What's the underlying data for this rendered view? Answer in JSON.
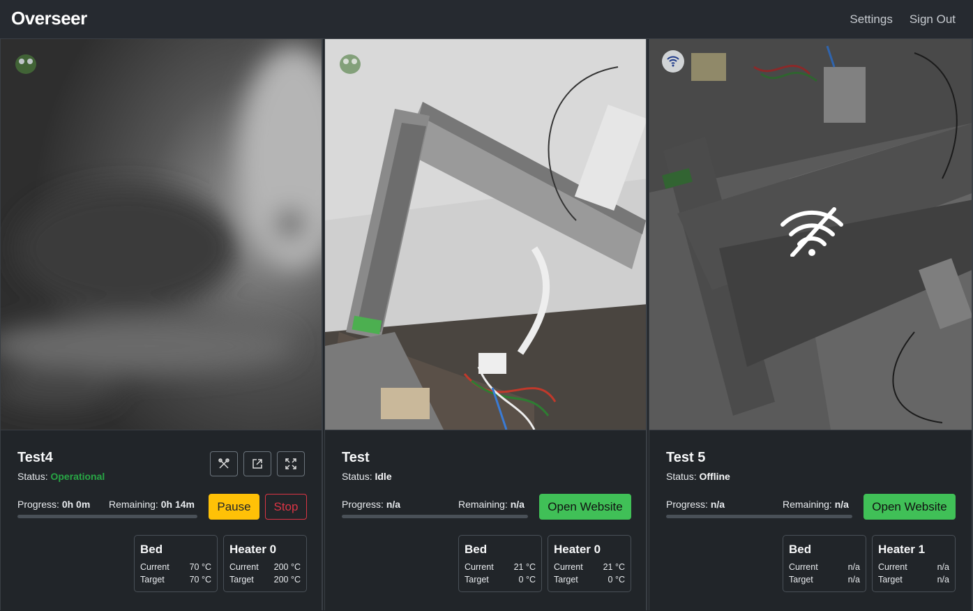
{
  "nav": {
    "brand": "Overseer",
    "settings": "Settings",
    "sign_out": "Sign Out"
  },
  "printers": [
    {
      "name": "Test4",
      "status_label": "Status:",
      "status": "Operational",
      "progress_label": "Progress:",
      "progress": "0h 0m",
      "remaining_label": "Remaining:",
      "remaining": "0h 14m",
      "pause": "Pause",
      "stop": "Stop",
      "temps": [
        {
          "name": "Bed",
          "current_label": "Current",
          "current": "70 °C",
          "target_label": "Target",
          "target": "70 °C"
        },
        {
          "name": "Heater 0",
          "current_label": "Current",
          "current": "200 °C",
          "target_label": "Target",
          "target": "200 °C"
        }
      ]
    },
    {
      "name": "Test",
      "status_label": "Status:",
      "status": "Idle",
      "progress_label": "Progress:",
      "progress": "n/a",
      "remaining_label": "Remaining:",
      "remaining": "n/a",
      "open_website": "Open Website",
      "temps": [
        {
          "name": "Bed",
          "current_label": "Current",
          "current": "21 °C",
          "target_label": "Target",
          "target": "0 °C"
        },
        {
          "name": "Heater 0",
          "current_label": "Current",
          "current": "21 °C",
          "target_label": "Target",
          "target": "0 °C"
        }
      ]
    },
    {
      "name": "Test 5",
      "status_label": "Status:",
      "status": "Offline",
      "progress_label": "Progress:",
      "progress": "n/a",
      "remaining_label": "Remaining:",
      "remaining": "n/a",
      "open_website": "Open Website",
      "temps": [
        {
          "name": "Bed",
          "current_label": "Current",
          "current": "n/a",
          "target_label": "Target",
          "target": "n/a"
        },
        {
          "name": "Heater 1",
          "current_label": "Current",
          "current": "n/a",
          "target_label": "Target",
          "target": "n/a"
        }
      ]
    }
  ]
}
